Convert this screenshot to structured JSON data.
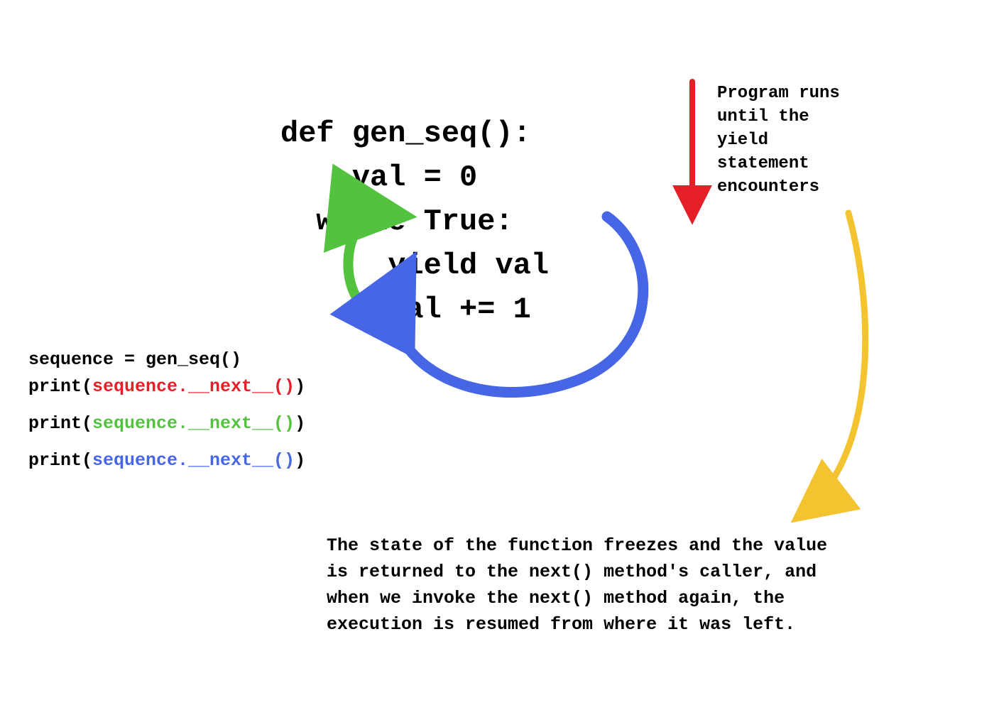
{
  "code_main": {
    "l1": "def gen_seq():",
    "l2": "    val = 0",
    "l3": "  while True:",
    "l4": "      yield val",
    "l5": "      val += 1"
  },
  "caller": {
    "assign_pre": "sequence = gen_seq()",
    "print_pre": "print(",
    "seq_call": "sequence.__next__()",
    "print_post": ")"
  },
  "annotations": {
    "run_until_yield": "Program runs until the yield statement encounters",
    "freeze_explain": "The state of the function freezes and the value is returned to the next() method's caller, and when we invoke the next() method again, the execution is resumed from where it was left."
  },
  "colors": {
    "red": "#e61e28",
    "green": "#53c23f",
    "blue": "#4666e5",
    "yellow": "#f4c430"
  }
}
